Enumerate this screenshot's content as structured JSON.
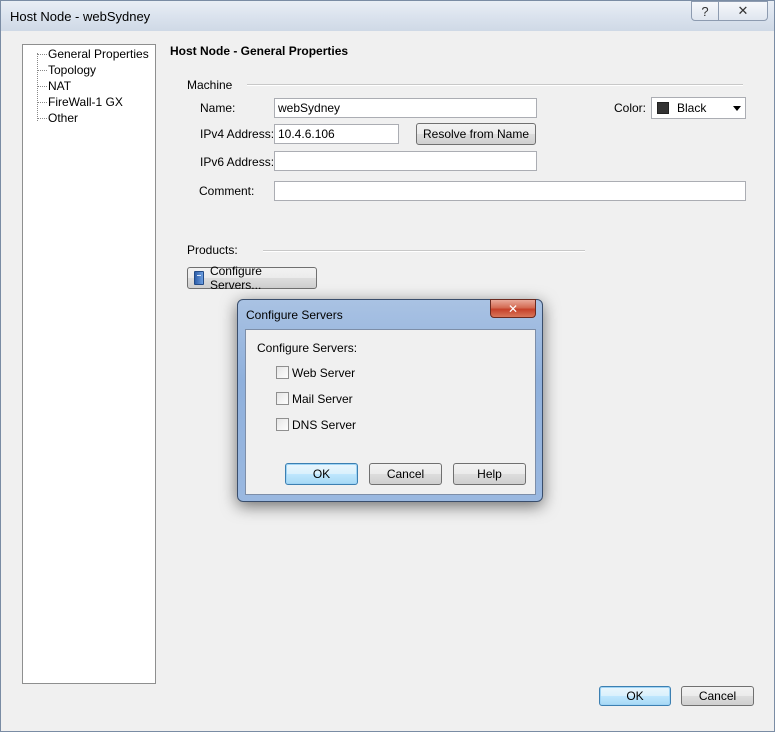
{
  "window": {
    "title": "Host Node - webSydney",
    "help_glyph": "?",
    "close_glyph": "✕"
  },
  "tree": {
    "items": [
      {
        "label": "General Properties"
      },
      {
        "label": "Topology"
      },
      {
        "label": "NAT"
      },
      {
        "label": "FireWall-1 GX"
      },
      {
        "label": "Other"
      }
    ]
  },
  "page": {
    "title": "Host Node - General Properties",
    "machine_group": "Machine",
    "name_label": "Name:",
    "name_value": "webSydney",
    "ipv4_label": "IPv4 Address:",
    "ipv4_value": "10.4.6.106",
    "resolve_button": "Resolve from Name",
    "ipv6_label": "IPv6 Address:",
    "ipv6_value": "",
    "comment_label": "Comment:",
    "comment_value": "",
    "color_label": "Color:",
    "color_value": "Black",
    "color_swatch": "#333333",
    "products_group": "Products:",
    "configure_servers_button": "Configure Servers..."
  },
  "dialog": {
    "title": "Configure Servers",
    "close_glyph": "✕",
    "heading": "Configure Servers:",
    "options": [
      {
        "label": "Web Server",
        "checked": false
      },
      {
        "label": "Mail Server",
        "checked": false
      },
      {
        "label": "DNS Server",
        "checked": false
      }
    ],
    "ok": "OK",
    "cancel": "Cancel",
    "help": "Help"
  },
  "footer": {
    "ok": "OK",
    "cancel": "Cancel"
  }
}
